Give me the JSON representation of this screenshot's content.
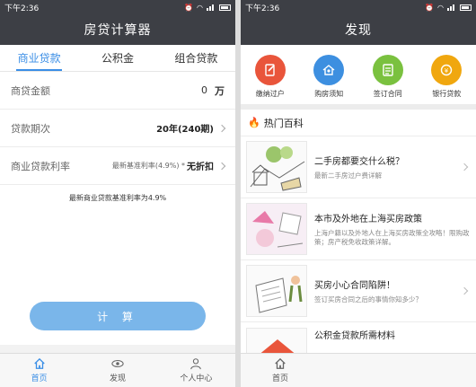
{
  "left": {
    "status_time": "下午2:36",
    "title": "房贷计算器",
    "tabs": [
      "商业贷款",
      "公积金",
      "组合贷款"
    ],
    "rows": {
      "amount_label": "商贷金额",
      "amount_value": "0",
      "amount_unit": "万",
      "term_label": "贷款期次",
      "term_value": "20年(240期)",
      "rate_label": "商业贷款利率",
      "rate_sub": "最新基准利率(4.9%) *",
      "rate_value": "无折扣"
    },
    "note": "最新商业贷款基准利率为4.9%",
    "calc_button": "计 算",
    "tabbar": [
      "首页",
      "发现",
      "个人中心"
    ]
  },
  "right": {
    "status_time": "下午2:36",
    "title": "发现",
    "quick": [
      {
        "label": "缴纳过户",
        "color": "#e9553b",
        "icon": "edit-icon"
      },
      {
        "label": "购房须知",
        "color": "#3d8fe0",
        "icon": "house-icon"
      },
      {
        "label": "签订合同",
        "color": "#7ac13f",
        "icon": "contract-icon"
      },
      {
        "label": "银行贷款",
        "color": "#f0a70f",
        "icon": "coin-icon"
      }
    ],
    "hot_title": "热门百科",
    "articles": [
      {
        "title": "二手房都要交什么税？",
        "desc": "最新二手房过户费详解"
      },
      {
        "title": "本市及外地在上海买房政策",
        "desc": "上海户籍以及外地人在上海买房政策全攻略！限购政策；房产税免收政策详解。"
      },
      {
        "title": "买房小心合同陷阱！",
        "desc": "签订买房合同之后的事情你知多少？"
      },
      {
        "title": "公积金贷款所需材料",
        "desc": ""
      }
    ],
    "tabbar": [
      "首页"
    ]
  }
}
